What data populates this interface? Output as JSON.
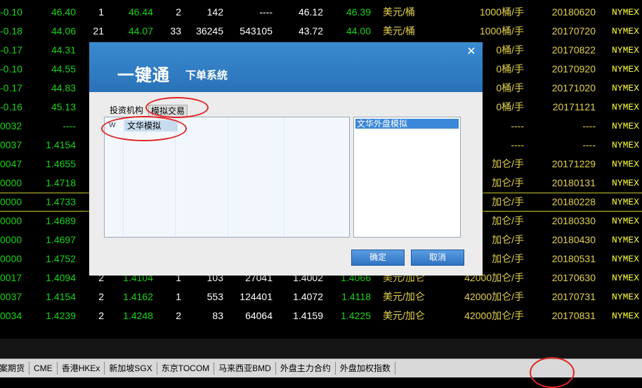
{
  "rows": [
    {
      "cells": [
        "-0.10",
        "46.40",
        "1",
        "46.44",
        "2",
        "142",
        "----",
        "46.12",
        "46.39",
        "美元/桶",
        "1000桶/手",
        "20180620",
        "NYMEX"
      ]
    },
    {
      "cells": [
        "-0.18",
        "44.06",
        "21",
        "44.07",
        "33",
        "36245",
        "543105",
        "43.72",
        "44.00",
        "美元/桶",
        "1000桶/手",
        "20170720",
        "NYMEX"
      ]
    },
    {
      "cells": [
        "-0.17",
        "44.31",
        "",
        "",
        "",
        "",
        "",
        "",
        "",
        "",
        "",
        "20170822",
        "NYMEX"
      ],
      "right_text": "0桶/手"
    },
    {
      "cells": [
        "-0.10",
        "44.55",
        "",
        "",
        "",
        "",
        "",
        "",
        "",
        "",
        "",
        "20170920",
        "NYMEX"
      ],
      "right_text": "0桶/手"
    },
    {
      "cells": [
        "-0.17",
        "44.83",
        "",
        "",
        "",
        "",
        "",
        "",
        "",
        "",
        "",
        "20171020",
        "NYMEX"
      ],
      "right_text": "0桶/手"
    },
    {
      "cells": [
        "-0.16",
        "45.13",
        "",
        "",
        "",
        "",
        "",
        "",
        "",
        "",
        "",
        "20171121",
        "NYMEX"
      ],
      "right_text": "0桶/手"
    },
    {
      "cells": [
        "0032",
        "----",
        "",
        "",
        "",
        "",
        "",
        "",
        "",
        "",
        "----",
        "----",
        "NYMEX"
      ]
    },
    {
      "cells": [
        "0037",
        "1.4154",
        "",
        "",
        "",
        "",
        "",
        "",
        "",
        "",
        "----",
        "----",
        "NYMEX"
      ]
    },
    {
      "cells": [
        "0047",
        "1.4655",
        "",
        "",
        "",
        "",
        "",
        "",
        "",
        "",
        "加仑/手",
        "20171229",
        "NYMEX"
      ]
    },
    {
      "cells": [
        "0000",
        "1.4718",
        "",
        "",
        "",
        "",
        "",
        "",
        "",
        "",
        "加仑/手",
        "20180131",
        "NYMEX"
      ]
    },
    {
      "cells": [
        "0000",
        "1.4733",
        "",
        "",
        "",
        "",
        "",
        "",
        "",
        "",
        "加仑/手",
        "20180228",
        "NYMEX"
      ]
    },
    {
      "cells": [
        "0000",
        "1.4689",
        "",
        "",
        "",
        "",
        "",
        "",
        "",
        "",
        "加仑/手",
        "20180330",
        "NYMEX"
      ]
    },
    {
      "cells": [
        "0000",
        "1.4697",
        "",
        "",
        "",
        "",
        "",
        "",
        "",
        "",
        "加仑/手",
        "20180430",
        "NYMEX"
      ]
    },
    {
      "cells": [
        "0000",
        "1.4752",
        "",
        "",
        "",
        "",
        "",
        "",
        "",
        "",
        "加仑/手",
        "20180531",
        "NYMEX"
      ]
    },
    {
      "cells": [
        "0017",
        "1.4094",
        "2",
        "1.4104",
        "1",
        "103",
        "27041",
        "1.4002",
        "1.4066",
        "美元/加仑",
        "42000加仑/手",
        "20170630",
        "NYMEX"
      ]
    },
    {
      "cells": [
        "0037",
        "1.4154",
        "2",
        "1.4162",
        "1",
        "553",
        "124401",
        "1.4072",
        "1.4118",
        "美元/加仑",
        "42000加仑/手",
        "20170731",
        "NYMEX"
      ]
    },
    {
      "cells": [
        "0034",
        "1.4239",
        "2",
        "1.4248",
        "2",
        "83",
        "64064",
        "1.4159",
        "1.4225",
        "美元/加仑",
        "42000加仑/手",
        "20170831",
        "NYMEX"
      ]
    }
  ],
  "market_tabs": [
    "案期货",
    "CME",
    "香港HKEx",
    "新加坡SGX",
    "东京TOCOM",
    "马来西亚BMD",
    "外盘主力合约",
    "外盘加权指数"
  ],
  "dialog": {
    "title": "一键通",
    "subtitle": "下单系统",
    "close": "✕",
    "tabs": [
      "投资机构",
      "模拟交易"
    ],
    "left_item_marker": "W",
    "left_item": "文华模拟",
    "right_item": "文华外盘模拟",
    "ok": "确定",
    "cancel": "取消"
  },
  "colors": {
    "green": "#19d219",
    "white": "#ffffff",
    "gold": "#e3d24a",
    "yellow": "#ffff3c",
    "accent": "#2a72b8",
    "annotation": "#e02424"
  }
}
